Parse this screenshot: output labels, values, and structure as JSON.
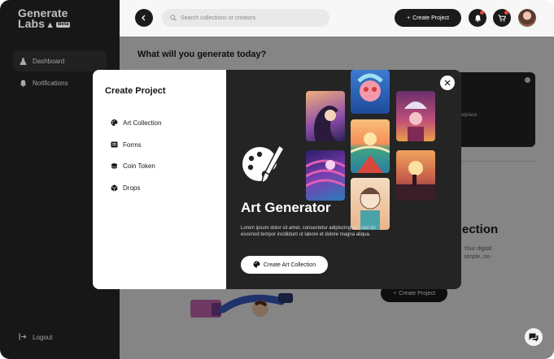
{
  "brand": {
    "line1": "Generate",
    "line2": "Labs",
    "badge": "Beta"
  },
  "sidebar": {
    "items": [
      {
        "label": "Dashboard",
        "icon": "flask-icon",
        "active": true
      },
      {
        "label": "Notifications",
        "icon": "bell-icon",
        "active": false
      }
    ],
    "logout_label": "Logout"
  },
  "topbar": {
    "search_placeholder": "Search collections or creators",
    "create_label": "Create Project"
  },
  "main": {
    "title": "What will you generate today?",
    "card_text": "rketplace",
    "section_heading": "ection",
    "section_sub": "Your digital simple, no-",
    "create_label": "Create Project"
  },
  "modal": {
    "title": "Create Project",
    "menu": [
      {
        "label": "Art Collection",
        "icon": "palette-icon"
      },
      {
        "label": "Forms",
        "icon": "form-icon"
      },
      {
        "label": "Coin Token",
        "icon": "coin-icon"
      },
      {
        "label": "Drops",
        "icon": "cube-icon"
      }
    ],
    "panel": {
      "title": "Art Generator",
      "description": "Lorem ipsum dolor sit amet, consectetur adipiscing elit, sed do eiusmod tempor incididunt ut labore et dolore magna aliqua.",
      "button_label": "Create Art Collection"
    }
  },
  "colors": {
    "dark": "#1b1b1b",
    "panel": "#242424",
    "notification_dot": "#e5463b"
  }
}
